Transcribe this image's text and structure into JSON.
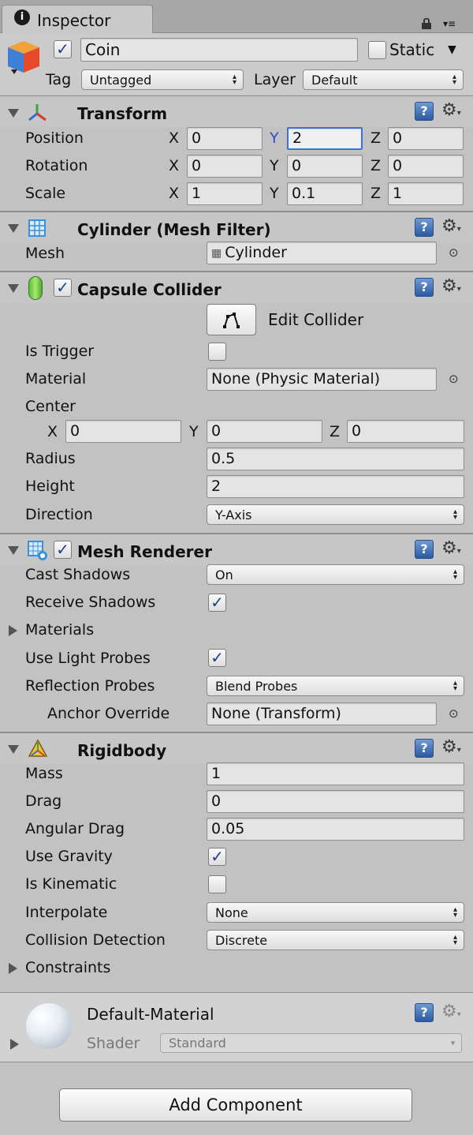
{
  "window": {
    "tab_title": "Inspector",
    "lock_icon": "lock-icon",
    "menu_icon": "tab-menu-icon"
  },
  "object": {
    "name": "Coin",
    "active": true,
    "static_label": "Static",
    "static": false,
    "tag_label": "Tag",
    "tag_value": "Untagged",
    "layer_label": "Layer",
    "layer_value": "Default"
  },
  "transform": {
    "title": "Transform",
    "position_label": "Position",
    "rotation_label": "Rotation",
    "scale_label": "Scale",
    "x": "X",
    "y": "Y",
    "z": "Z",
    "position": [
      "0",
      "2",
      "0"
    ],
    "rotation": [
      "0",
      "0",
      "0"
    ],
    "scale": [
      "1",
      "0.1",
      "1"
    ]
  },
  "mesh_filter": {
    "title": "Cylinder (Mesh Filter)",
    "mesh_label": "Mesh",
    "mesh_value": "Cylinder"
  },
  "capsule_collider": {
    "title": "Capsule Collider",
    "enabled": true,
    "edit_label": "Edit Collider",
    "is_trigger_label": "Is Trigger",
    "is_trigger": false,
    "material_label": "Material",
    "material_value": "None (Physic Material)",
    "center_label": "Center",
    "center": [
      "0",
      "0",
      "0"
    ],
    "radius_label": "Radius",
    "radius": "0.5",
    "height_label": "Height",
    "height": "2",
    "direction_label": "Direction",
    "direction": "Y-Axis"
  },
  "mesh_renderer": {
    "title": "Mesh Renderer",
    "enabled": true,
    "cast_shadows_label": "Cast Shadows",
    "cast_shadows": "On",
    "receive_shadows_label": "Receive Shadows",
    "receive_shadows": true,
    "materials_label": "Materials",
    "light_probes_label": "Use Light Probes",
    "light_probes": true,
    "reflection_probes_label": "Reflection Probes",
    "reflection_probes": "Blend Probes",
    "anchor_label": "Anchor Override",
    "anchor_value": "None (Transform)"
  },
  "rigidbody": {
    "title": "Rigidbody",
    "mass_label": "Mass",
    "mass": "1",
    "drag_label": "Drag",
    "drag": "0",
    "angular_drag_label": "Angular Drag",
    "angular_drag": "0.05",
    "use_gravity_label": "Use Gravity",
    "use_gravity": true,
    "is_kinematic_label": "Is Kinematic",
    "is_kinematic": false,
    "interpolate_label": "Interpolate",
    "interpolate": "None",
    "collision_label": "Collision Detection",
    "collision": "Discrete",
    "constraints_label": "Constraints"
  },
  "material": {
    "name": "Default-Material",
    "shader_label": "Shader",
    "shader_value": "Standard"
  },
  "add_component_label": "Add Component",
  "colors": {
    "background": "#c2c2c2",
    "focus": "#3a72d8",
    "check": "#1f3e8c"
  }
}
